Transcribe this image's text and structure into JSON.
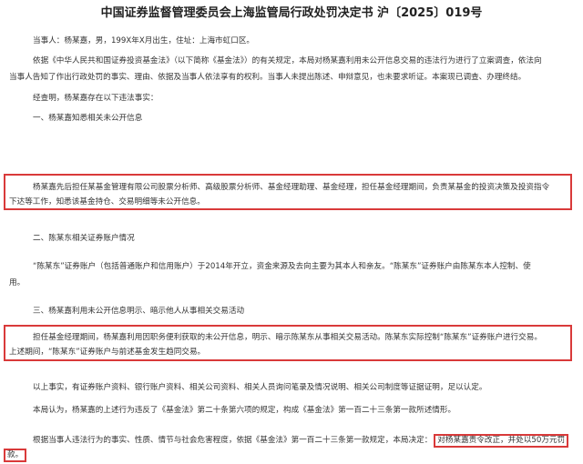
{
  "title": "中国证券监督管理委员会上海监管局行政处罚决定书 沪〔2025〕019号",
  "lines": {
    "party": "当事人：杨某嘉，男，199X年X月出生，住址：上海市虹口区。",
    "intro1": "依据《中华人民共和国证券投资基金法》（以下简称《基金法》）的有关规定，本局对杨某嘉利用未公开信息交易的违法行为进行了立案调查，依法向",
    "intro2": "当事人告知了作出行政处罚的事实、理由、依据及当事人依法享有的权利。当事人未提出陈述、申辩意见，也未要求听证。本案现已调查、办理终结。",
    "found": "经查明，杨某嘉存在以下违法事实：",
    "h1": "一、杨某嘉知悉相关未公开信息",
    "s1a": "杨某嘉先后担任某基金管理有限公司股票分析师、高级股票分析师、基金经理助理、基金经理，担任基金经理期间，负责某基金的投资决策及投资指令",
    "s1b": "下达等工作，知悉该基金持仓、交易明细等未公开信息。",
    "h2": "二、陈某东相关证券账户情况",
    "s2a": "“陈某东”证券账户（包括普通账户和信用账户）于2014年开立，资金来源及去向主要为其本人和亲友。“陈某东”证券账户由陈某东本人控制、使",
    "s2b": "用。",
    "h3": "三、杨某嘉利用未公开信息明示、暗示他人从事相关交易活动",
    "s3a": "担任基金经理期间，杨某嘉利用因职务便利获取的未公开信息，明示、暗示陈某东从事相关交易活动。陈某东实际控制“陈某东”证券账户进行交易。",
    "s3b": "上述期间，“陈某东”证券账户与前述基金发生趋同交易。",
    "evid": "以上事实，有证券账户资料、银行账户资料、相关公司资料、相关人员询问笔录及情况说明、相关公司制度等证据证明，足以认定。",
    "law": "本局认为，杨某嘉的上述行为违反了《基金法》第二十条第六项的规定，构成《基金法》第一百二十三条第一款所述情形。",
    "decision_pre": "根据当事人违法行为的事实、性质、情节与社会危害程度，依据《基金法》第一百二十三条第一款规定，本局决定：",
    "decision_boxed": "对杨某嘉责令改正，并处以50万元罚",
    "decision_end": "款。"
  }
}
